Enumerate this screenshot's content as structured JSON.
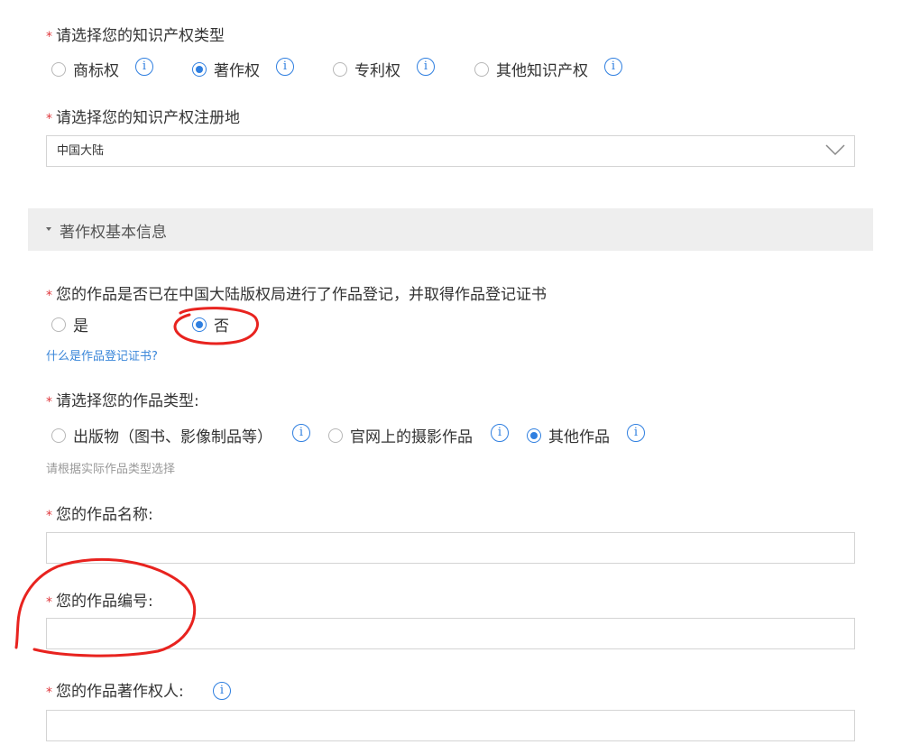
{
  "ip_type": {
    "label": "请选择您的知识产权类型",
    "required_mark": "*",
    "options": [
      {
        "label": "商标权",
        "checked": false
      },
      {
        "label": "著作权",
        "checked": true
      },
      {
        "label": "专利权",
        "checked": false
      },
      {
        "label": "其他知识产权",
        "checked": false
      }
    ],
    "info_glyph": "i"
  },
  "region": {
    "label": "请选择您的知识产权注册地",
    "required_mark": "*",
    "selected": "中国大陆",
    "icon": "chevron-down-icon"
  },
  "section": {
    "title": "著作权基本信息",
    "icon": "caret-down-icon"
  },
  "registration": {
    "label": "您的作品是否已在中国大陆版权局进行了作品登记，并取得作品登记证书",
    "required_mark": "*",
    "options": [
      {
        "label": "是",
        "checked": false
      },
      {
        "label": "否",
        "checked": true
      }
    ],
    "help_link": "什么是作品登记证书?"
  },
  "work_type": {
    "label": "请选择您的作品类型:",
    "required_mark": "*",
    "options": [
      {
        "label": "出版物（图书、影像制品等）",
        "checked": false
      },
      {
        "label": "官网上的摄影作品",
        "checked": false
      },
      {
        "label": "其他作品",
        "checked": true
      }
    ],
    "hint": "请根据实际作品类型选择"
  },
  "work_name": {
    "label": "您的作品名称:",
    "required_mark": "*",
    "value": ""
  },
  "work_number": {
    "label": "您的作品编号:",
    "required_mark": "*",
    "value": ""
  },
  "copyright_owner": {
    "label": "您的作品著作权人:",
    "required_mark": "*",
    "value": ""
  },
  "colors": {
    "accent": "#2f7fe0",
    "required": "#e0393e",
    "annotation": "#e8231f",
    "section_bg": "#eeeeee"
  }
}
